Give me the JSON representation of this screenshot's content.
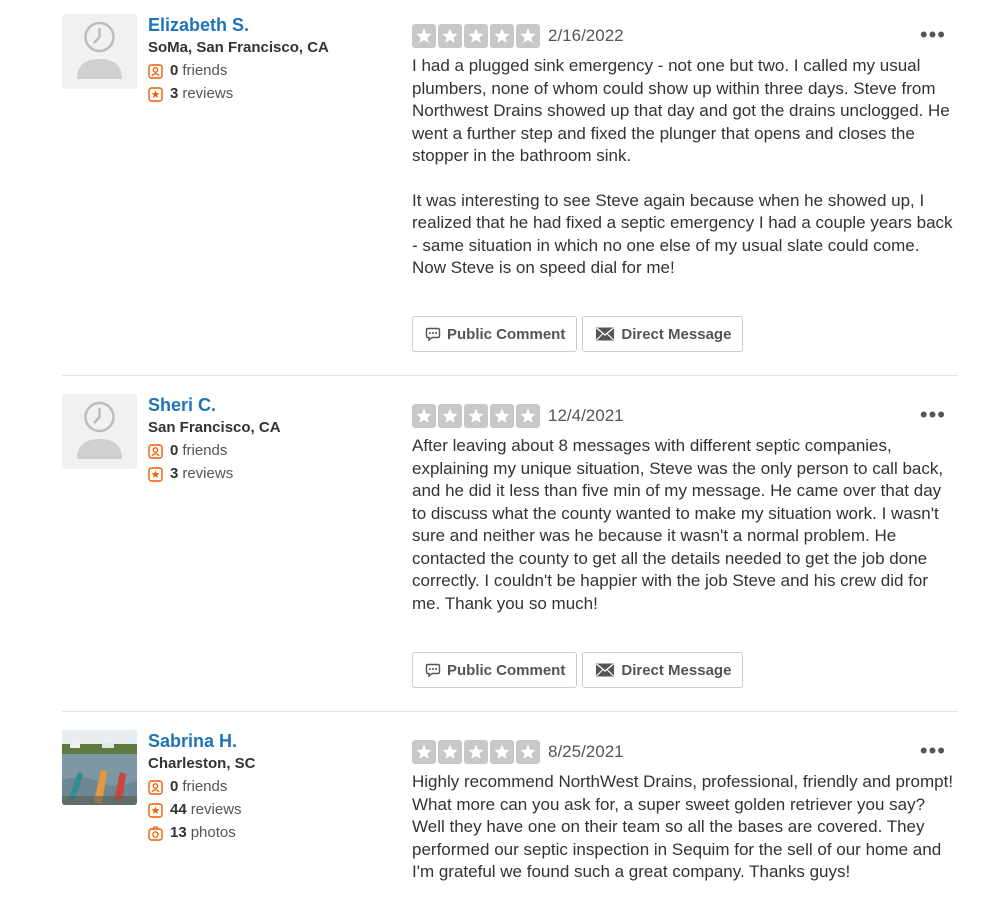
{
  "reviews": [
    {
      "user": {
        "name": "Elizabeth S.",
        "location": "SoMa, San Francisco, CA"
      },
      "stats": {
        "friends_count": "0",
        "friends_label": "friends",
        "reviews_count": "3",
        "reviews_label": "reviews"
      },
      "rating": 5,
      "date": "2/16/2022",
      "more_label": "•••",
      "paragraphs": [
        "I had a plugged sink emergency - not one but two. I called my usual plumbers, none of whom could show up within three days. Steve from Northwest Drains showed up that day and got the drains unclogged. He went a further step and fixed the plunger that opens and closes the stopper in the bathroom sink.",
        "It was interesting to see Steve again because when he showed up, I realized that he had fixed a septic emergency I had a couple years back - same situation in which no one else of my usual slate could come. Now Steve is on speed dial for me!"
      ],
      "actions": {
        "public_comment": "Public Comment",
        "direct_message": "Direct Message"
      }
    },
    {
      "user": {
        "name": "Sheri C.",
        "location": "San Francisco, CA"
      },
      "stats": {
        "friends_count": "0",
        "friends_label": "friends",
        "reviews_count": "3",
        "reviews_label": "reviews"
      },
      "rating": 5,
      "date": "12/4/2021",
      "more_label": "•••",
      "paragraphs": [
        "After leaving about 8 messages with different septic companies, explaining my unique situation, Steve was the only person to call back, and he did it less than five min of my message. He came over that day to discuss what the county wanted to make my situation work. I wasn't sure and neither was he because it wasn't a normal problem. He contacted the county to get all the details needed to get the job done correctly. I couldn't be happier with the job Steve and his crew did for me. Thank you so much!"
      ],
      "actions": {
        "public_comment": "Public Comment",
        "direct_message": "Direct Message"
      }
    },
    {
      "user": {
        "name": "Sabrina H.",
        "location": "Charleston, SC"
      },
      "stats": {
        "friends_count": "0",
        "friends_label": "friends",
        "reviews_count": "44",
        "reviews_label": "reviews",
        "photos_count": "13",
        "photos_label": "photos"
      },
      "rating": 5,
      "date": "8/25/2021",
      "more_label": "•••",
      "paragraphs": [
        "Highly recommend NorthWest Drains, professional, friendly and prompt! What more can you ask for, a super sweet golden retriever you say? Well they have one on their team so all the bases are covered. They performed our septic inspection in Sequim for the sell of our home and I'm grateful we found such a great company. Thanks guys!"
      ]
    }
  ],
  "colors": {
    "accent_link": "#1f74b8",
    "stat_icon": "#f15c00",
    "star_empty": "#c8c8c8"
  },
  "icons": {
    "friends": "friends-icon",
    "reviews": "review-star-icon",
    "photos": "camera-icon",
    "comment": "speech-bubble-icon",
    "message": "envelope-icon",
    "more": "more-dots-icon"
  }
}
